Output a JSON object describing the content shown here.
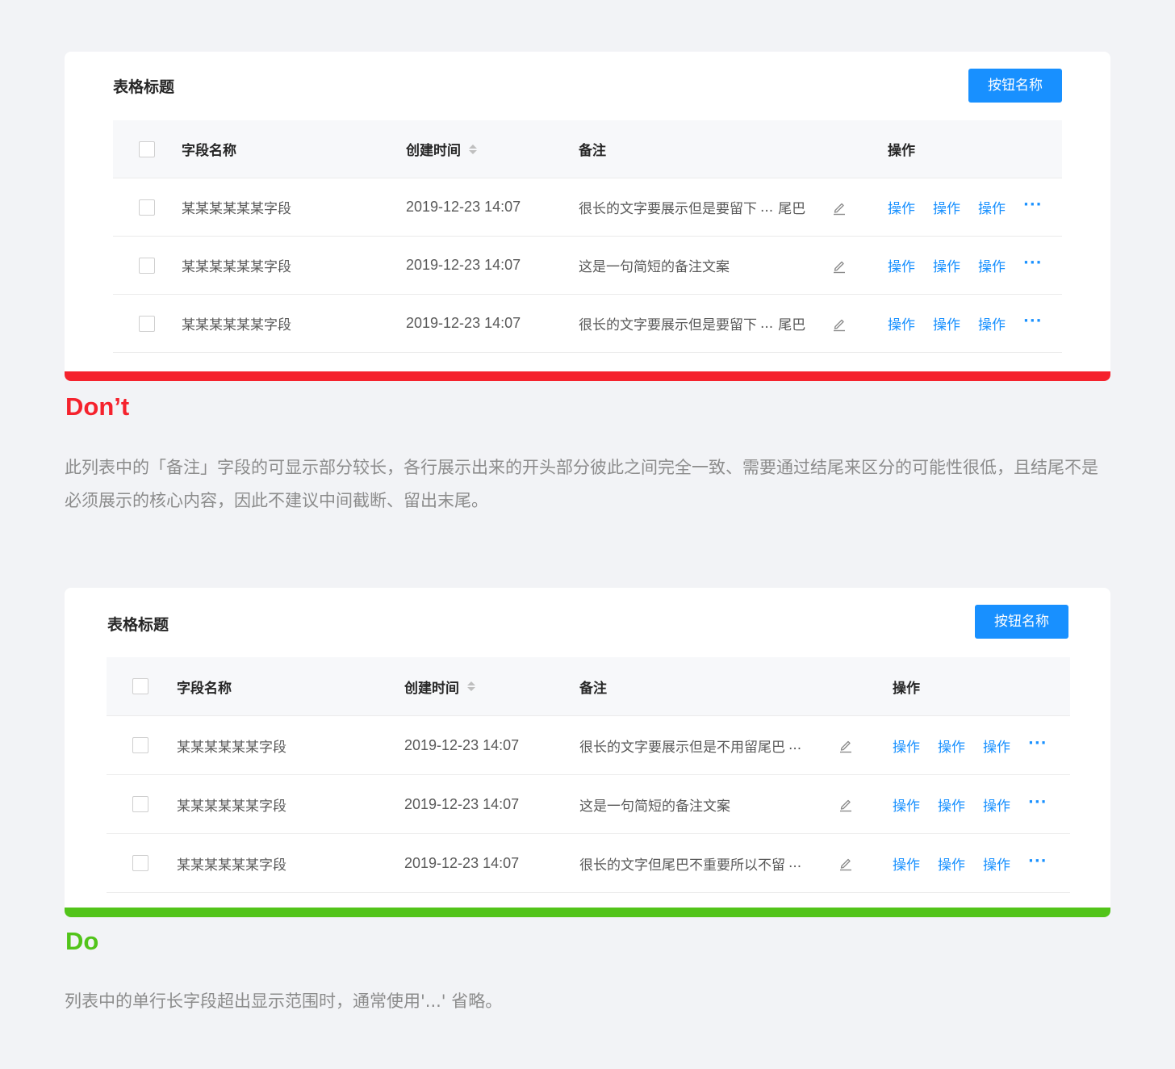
{
  "examples": {
    "dont": {
      "table_title": "表格标题",
      "button_label": "按钮名称",
      "columns": {
        "name": "字段名称",
        "time": "创建时间",
        "note": "备注",
        "ops": "操作"
      },
      "rows": [
        {
          "name": "某某某某某某字段",
          "time": "2019-12-23 14:07",
          "note": "很长的文字要展示但是要留下",
          "ellipsis": "...",
          "tail": "尾巴"
        },
        {
          "name": "某某某某某某字段",
          "time": "2019-12-23 14:07",
          "note": "这是一句简短的备注文案",
          "ellipsis": "",
          "tail": ""
        },
        {
          "name": "某某某某某某字段",
          "time": "2019-12-23 14:07",
          "note": "很长的文字要展示但是要留下",
          "ellipsis": "...",
          "tail": "尾巴"
        }
      ],
      "op_labels": [
        "操作",
        "操作",
        "操作"
      ],
      "more": "···",
      "verdict": "Don’t",
      "description": "此列表中的「备注」字段的可显示部分较长，各行展示出来的开头部分彼此之间完全一致、需要通过结尾来区分的可能性很低，且结尾不是必须展示的核心内容，因此不建议中间截断、留出末尾。",
      "accent_color": "#f5222d"
    },
    "do": {
      "table_title": "表格标题",
      "button_label": "按钮名称",
      "columns": {
        "name": "字段名称",
        "time": "创建时间",
        "note": "备注",
        "ops": "操作"
      },
      "rows": [
        {
          "name": "某某某某某某字段",
          "time": "2019-12-23 14:07",
          "note": "很长的文字要展示但是不用留尾巴",
          "ellipsis": "...",
          "tail": ""
        },
        {
          "name": "某某某某某某字段",
          "time": "2019-12-23 14:07",
          "note": "这是一句简短的备注文案",
          "ellipsis": "",
          "tail": ""
        },
        {
          "name": "某某某某某某字段",
          "time": "2019-12-23 14:07",
          "note": "很长的文字但尾巴不重要所以不留",
          "ellipsis": "...",
          "tail": ""
        }
      ],
      "op_labels": [
        "操作",
        "操作",
        "操作"
      ],
      "more": "···",
      "verdict": "Do",
      "description": "列表中的单行长字段超出显示范围时，通常使用'...' 省略。",
      "accent_color": "#52c41a"
    }
  },
  "colors": {
    "primary": "#1890ff",
    "page_background": "#f2f3f6"
  },
  "icons": {
    "edit": "edit-pencil-icon",
    "sort": "sort-caret-icon",
    "more": "more-ellipsis-icon"
  }
}
